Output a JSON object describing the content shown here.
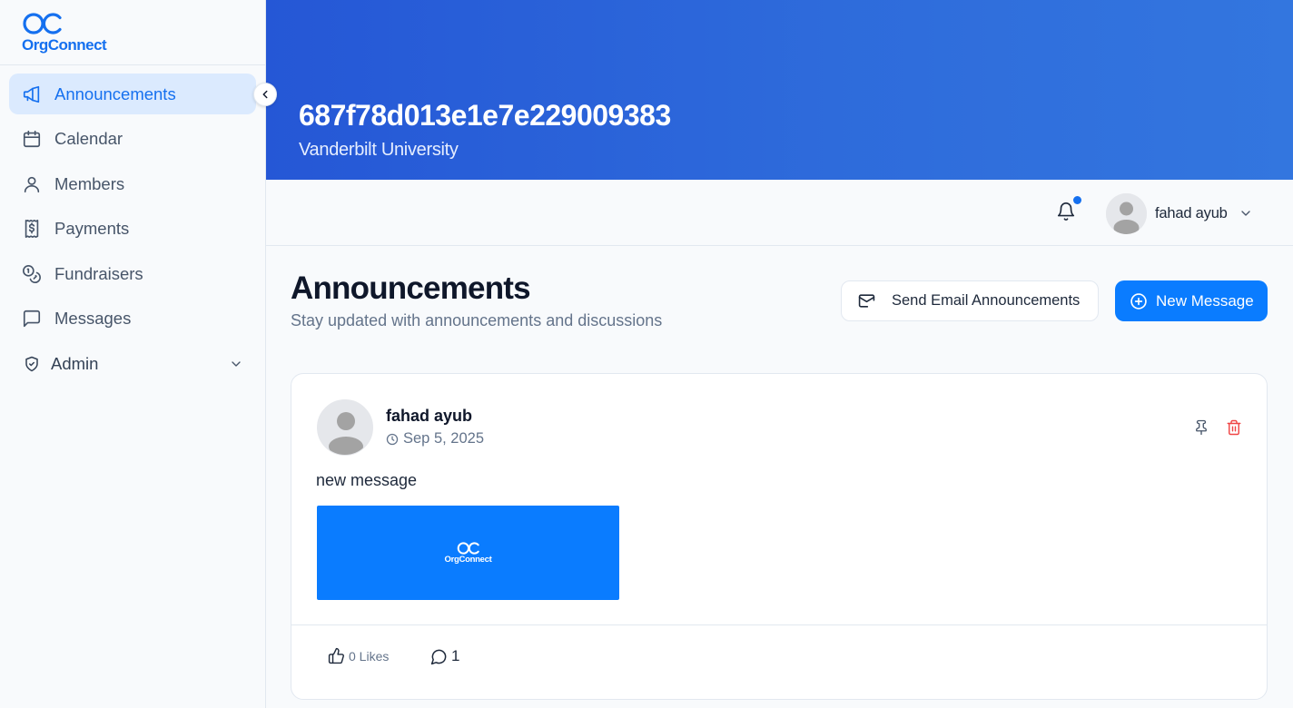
{
  "app": {
    "logo_text": "OrgConnect",
    "accent_color": "#1570ef"
  },
  "sidebar": {
    "items": [
      {
        "label": "Announcements",
        "icon": "megaphone-icon",
        "active": true
      },
      {
        "label": "Calendar",
        "icon": "calendar-icon"
      },
      {
        "label": "Members",
        "icon": "user-icon"
      },
      {
        "label": "Payments",
        "icon": "receipt-dollar-icon"
      },
      {
        "label": "Fundraisers",
        "icon": "coins-icon"
      },
      {
        "label": "Messages",
        "icon": "message-square-icon"
      },
      {
        "label": "Admin",
        "icon": "shield-check-icon"
      }
    ]
  },
  "header": {
    "org_id": "687f78d013e1e7e229009383",
    "org_name": "Vanderbilt University"
  },
  "topbar": {
    "user_name": "fahad ayub",
    "has_notification": true
  },
  "main": {
    "title": "Announcements",
    "subtitle": "Stay updated with announcements and discussions",
    "send_email_label": "Send Email Announcements",
    "new_message_label": "New Message"
  },
  "post": {
    "author": "fahad ayub",
    "date": "Sep 5, 2025",
    "text": "new message",
    "image_logo_text": "OrgConnect",
    "likes_label": "0 Likes",
    "comments_count": "1"
  }
}
